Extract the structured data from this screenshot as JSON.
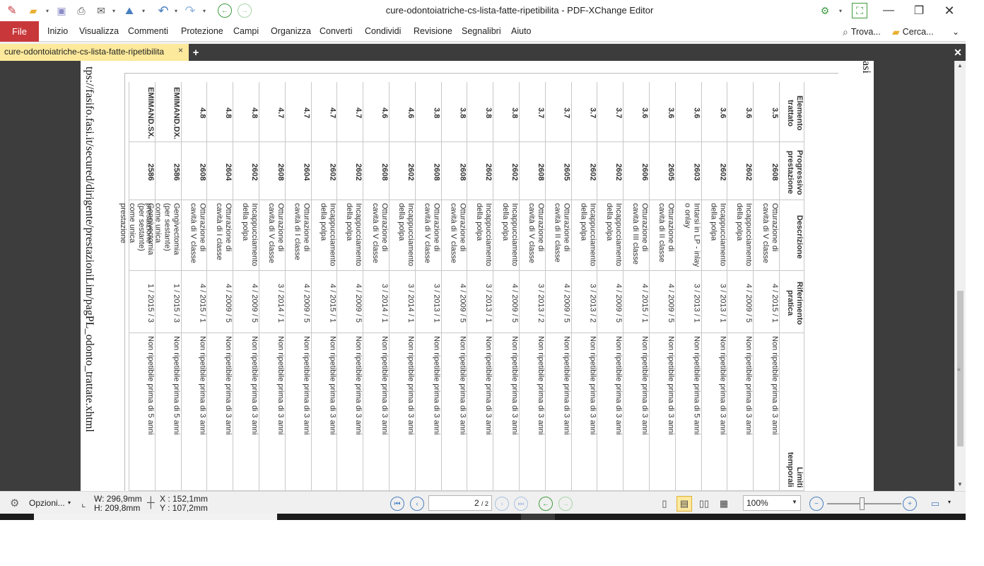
{
  "window": {
    "title": "cure-odontoiatriche-cs-lista-fatte-ripetibilita - PDF-XChange Editor"
  },
  "menu": {
    "file": "File",
    "items": [
      "Inizio",
      "Visualizza",
      "Commenti",
      "Protezione",
      "Campi",
      "Organizza",
      "Converti",
      "Condividi",
      "Revisione",
      "Segnalibri",
      "Aiuto"
    ],
    "find": "Trova...",
    "search": "Cerca..."
  },
  "tab": {
    "label": "cure-odontoiatriche-cs-lista-fatte-ripetibilita"
  },
  "document": {
    "url": "tps://fasifo.fasi.it/secured/dirigente/prestazioniLim/pagPL_odonto_trattate.xhtml",
    "right_fragment": "asi",
    "headers": {
      "elemento": "Elemento\ntrattato",
      "progressivo": "Progressivo\nprestazione",
      "descrizione": "Descrizione",
      "riferimento": "Riferimento\npratica",
      "limiti": "Limiti\ntemporali"
    },
    "rows": [
      {
        "elem": "3.5",
        "prog": "2608",
        "desc": "Otturazione di\ncavità di V classe",
        "rif": "4 / 2015 / 1",
        "lim": "Non ripetibile prima di 3 anni"
      },
      {
        "elem": "3.6",
        "prog": "2602",
        "desc": "Incappucciamento\ndella polpa",
        "rif": "4 / 2009 / 5",
        "lim": "Non ripetibile prima di 3 anni"
      },
      {
        "elem": "3.6",
        "prog": "2602",
        "desc": "Incappucciamento\ndella polpa",
        "rif": "3 / 2013 / 1",
        "lim": "Non ripetibile prima di 3 anni"
      },
      {
        "elem": "3.6",
        "prog": "2603",
        "desc": "Intarsi in LP - inlay\no onlay",
        "rif": "3 / 2013 / 1",
        "lim": "Non ripetibile prima di 5 anni"
      },
      {
        "elem": "3.6",
        "prog": "2605",
        "desc": "Otturazione di\ncavità di II classe",
        "rif": "4 / 2009 / 5",
        "lim": "Non ripetibile prima di 3 anni"
      },
      {
        "elem": "3.6",
        "prog": "2606",
        "desc": "Otturazione di\ncavità di III classe",
        "rif": "4 / 2015 / 1",
        "lim": "Non ripetibile prima di 3 anni"
      },
      {
        "elem": "3.7",
        "prog": "2602",
        "desc": "Incappucciamento\ndella polpa",
        "rif": "4 / 2009 / 5",
        "lim": "Non ripetibile prima di 3 anni"
      },
      {
        "elem": "3.7",
        "prog": "2602",
        "desc": "Incappucciamento\ndella polpa",
        "rif": "3 / 2013 / 2",
        "lim": "Non ripetibile prima di 3 anni"
      },
      {
        "elem": "3.7",
        "prog": "2605",
        "desc": "Otturazione di\ncavità di II classe",
        "rif": "4 / 2009 / 5",
        "lim": "Non ripetibile prima di 3 anni"
      },
      {
        "elem": "3.7",
        "prog": "2608",
        "desc": "Otturazione di\ncavità di V classe",
        "rif": "3 / 2013 / 2",
        "lim": "Non ripetibile prima di 3 anni"
      },
      {
        "elem": "3.8",
        "prog": "2602",
        "desc": "Incappucciamento\ndella polpa",
        "rif": "4 / 2009 / 5",
        "lim": "Non ripetibile prima di 3 anni"
      },
      {
        "elem": "3.8",
        "prog": "2602",
        "desc": "Incappucciamento\ndella polpa",
        "rif": "3 / 2013 / 1",
        "lim": "Non ripetibile prima di 3 anni"
      },
      {
        "elem": "3.8",
        "prog": "2608",
        "desc": "Otturazione di\ncavità di V classe",
        "rif": "4 / 2009 / 5",
        "lim": "Non ripetibile prima di 3 anni"
      },
      {
        "elem": "3.8",
        "prog": "2608",
        "desc": "Otturazione di\ncavità di V classe",
        "rif": "3 / 2013 / 1",
        "lim": "Non ripetibile prima di 3 anni"
      },
      {
        "elem": "4.6",
        "prog": "2602",
        "desc": "Incappucciamento\ndella polpa",
        "rif": "3 / 2014 / 1",
        "lim": "Non ripetibile prima di 3 anni"
      },
      {
        "elem": "4.6",
        "prog": "2608",
        "desc": "Otturazione di\ncavità di V classe",
        "rif": "3 / 2014 / 1",
        "lim": "Non ripetibile prima di 3 anni"
      },
      {
        "elem": "4.7",
        "prog": "2602",
        "desc": "Incappucciamento\ndella polpa",
        "rif": "4 / 2009 / 5",
        "lim": "Non ripetibile prima di 3 anni"
      },
      {
        "elem": "4.7",
        "prog": "2602",
        "desc": "Incappucciamento\ndella polpa",
        "rif": "4 / 2015 / 1",
        "lim": "Non ripetibile prima di 3 anni"
      },
      {
        "elem": "4.7",
        "prog": "2604",
        "desc": "Otturazione di\ncavità di I classe",
        "rif": "4 / 2009 / 5",
        "lim": "Non ripetibile prima di 3 anni"
      },
      {
        "elem": "4.7",
        "prog": "2608",
        "desc": "Otturazione di\ncavità di V classe",
        "rif": "3 / 2014 / 1",
        "lim": "Non ripetibile prima di 3 anni"
      },
      {
        "elem": "4.8",
        "prog": "2602",
        "desc": "Incappucciamento\ndella polpa",
        "rif": "4 / 2009 / 5",
        "lim": "Non ripetibile prima di 3 anni"
      },
      {
        "elem": "4.8",
        "prog": "2604",
        "desc": "Otturazione di\ncavità di I classe",
        "rif": "4 / 2009 / 5",
        "lim": "Non ripetibile prima di 3 anni"
      },
      {
        "elem": "4.8",
        "prog": "2608",
        "desc": "Otturazione di\ncavità di V classe",
        "rif": "4 / 2015 / 1",
        "lim": "Non ripetibile prima di 3 anni"
      },
      {
        "elem": "EMIMAND.DX.",
        "prog": "2586",
        "desc": "Gengivectomia\n(per sestante)\ncome unica\nprestazione",
        "rif": "1 / 2015 / 3",
        "lim": "Non ripetibile prima di 5 anni"
      },
      {
        "elem": "EMIMAND.SX.",
        "prog": "2586",
        "desc": "Gengivectomia\n(per sestante)\ncome unica\nprestazione",
        "rif": "1 / 2015 / 3",
        "lim": "Non ripetibile prima di 5 anni"
      }
    ]
  },
  "status": {
    "options": "Opzioni...",
    "width": "W: 296,9mm",
    "height": "H: 209,8mm",
    "x": "X : 152,1mm",
    "y": "Y : 107,2mm",
    "page_value": "2",
    "page_total": "/ 2",
    "zoom": "100%"
  },
  "colors": {
    "file_button": "#c8383b",
    "tab_active": "#fce99b",
    "nav_blue": "#4a7fc1",
    "nav_green": "#3e9b3e"
  }
}
